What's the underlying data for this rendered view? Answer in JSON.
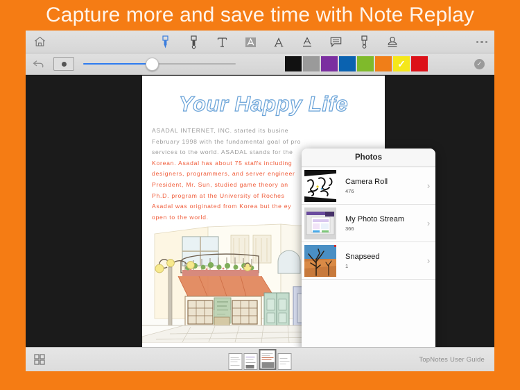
{
  "promo": {
    "headline": "Capture more and save time with Note Replay",
    "background_color": "#F57C14",
    "text_color": "#FFF4EA"
  },
  "toolbar_top": {
    "home_icon": "home-icon",
    "tools": [
      {
        "name": "pen-tool",
        "glyph": "pen",
        "active": true,
        "label": "Pen"
      },
      {
        "name": "marker-tool",
        "glyph": "marker",
        "active": false,
        "label": "Marker"
      },
      {
        "name": "text-tool",
        "glyph": "T",
        "active": false,
        "label": "Text"
      },
      {
        "name": "highlight-tool",
        "glyph": "A-boxed",
        "active": false,
        "label": "Text Highlight"
      },
      {
        "name": "font-tool",
        "glyph": "A",
        "active": false,
        "label": "Font"
      },
      {
        "name": "underline-tool",
        "glyph": "A-under",
        "active": false,
        "label": "Underline"
      },
      {
        "name": "comment-tool",
        "glyph": "speech",
        "active": false,
        "label": "Comment"
      },
      {
        "name": "eraser-tool",
        "glyph": "eraser",
        "active": false,
        "label": "Eraser"
      },
      {
        "name": "stamp-tool",
        "glyph": "stamp",
        "active": false,
        "label": "Stamp"
      }
    ],
    "more_label": "More"
  },
  "toolbar_second": {
    "undo_label": "Undo",
    "brush_shape_label": "Brush shape",
    "slider": {
      "name": "thickness-slider",
      "value_percent": 45,
      "fill_color": "#2d7bf0",
      "track_color": "#b3b3b3"
    },
    "colors": [
      {
        "name": "black",
        "hex": "#111111",
        "selected": false
      },
      {
        "name": "gray",
        "hex": "#9a9a9a",
        "selected": false
      },
      {
        "name": "purple",
        "hex": "#7b2fa0",
        "selected": false
      },
      {
        "name": "blue",
        "hex": "#0a62b0",
        "selected": false
      },
      {
        "name": "green",
        "hex": "#7fba2b",
        "selected": false
      },
      {
        "name": "orange",
        "hex": "#F07E18",
        "selected": false
      },
      {
        "name": "yellow",
        "hex": "#F5E71A",
        "selected": true
      },
      {
        "name": "red",
        "hex": "#DC1119",
        "selected": false
      }
    ],
    "confirm_label": "Done",
    "confirm_glyph": "✓"
  },
  "document": {
    "title": "Your Happy Life",
    "title_outline_color": "#6aa3d8",
    "body_grey_color": "#9b9b9b",
    "body_red_color": "#f05a37",
    "body_lines": [
      {
        "text": "ASADAL INTERNET, INC. started its busine",
        "color": "grey"
      },
      {
        "text": "February 1998 with the fundamental goal of pro",
        "color": "grey"
      },
      {
        "text": "services to the world. ASADAL stands for the",
        "color": "grey"
      },
      {
        "text": " Korean. Asadal has about 75 staffs including",
        "color": "mixed"
      },
      {
        "text": "designers, programmers, and server engineer",
        "color": "red"
      },
      {
        "text": "President, Mr. Sun, studied game theory an",
        "color": "red"
      },
      {
        "text": " Ph.D. program at the University of Roches",
        "color": "red"
      },
      {
        "text": "Asadal was originated from Korea but the ey",
        "color": "red"
      },
      {
        "text": "open to the world.",
        "color": "red"
      }
    ],
    "illustration_name": "watercolor-street-scene",
    "photo_name": "shopping-legs-photo"
  },
  "photos_popover": {
    "title": "Photos",
    "albums": [
      {
        "name": "Camera Roll",
        "count": "476",
        "thumb": "sketch-thumbnail"
      },
      {
        "name": "My Photo Stream",
        "count": "366",
        "thumb": "screenshot-thumbnail"
      },
      {
        "name": "Snapseed",
        "count": "1",
        "thumb": "desert-thumbnail"
      }
    ],
    "chevron_glyph": "›"
  },
  "toolbar_bottom": {
    "grid_label": "Page grid",
    "pages": [
      {
        "name": "page-thumb-1",
        "current": false
      },
      {
        "name": "page-thumb-2",
        "current": false
      },
      {
        "name": "page-thumb-3",
        "current": true
      },
      {
        "name": "page-thumb-4",
        "current": false
      }
    ],
    "document_name": "TopNotes User Guide"
  }
}
